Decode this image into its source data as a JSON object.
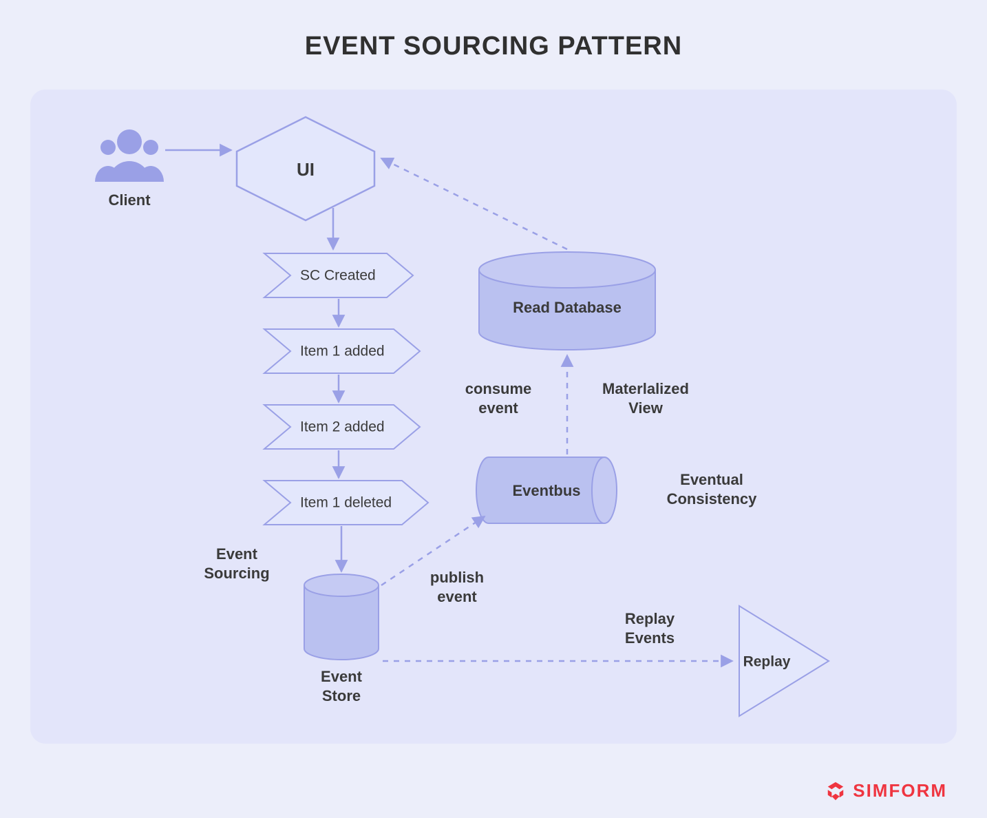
{
  "title": "EVENT SOURCING PATTERN",
  "brand": "SIMFORM",
  "nodes": {
    "client": "Client",
    "ui": "UI",
    "readdb": "Read Database",
    "eventbus": "Eventbus",
    "eventstore_l1": "Event",
    "eventstore_l2": "Store",
    "replay": "Replay"
  },
  "events": {
    "e1": "SC Created",
    "e2": "Item 1 added",
    "e3": "Item 2 added",
    "e4": "Item 1 deleted"
  },
  "labels": {
    "consume_l1": "consume",
    "consume_l2": "event",
    "matview_l1": "Materlalized",
    "matview_l2": "View",
    "eventual_l1": "Eventual",
    "eventual_l2": "Consistency",
    "evtsrc_l1": "Event",
    "evtsrc_l2": "Sourcing",
    "publish_l1": "publish",
    "publish_l2": "event",
    "replayevt_l1": "Replay",
    "replayevt_l2": "Events"
  },
  "colors": {
    "stroke": "#9aa0e6",
    "fillLight": "#e3e7fc",
    "fillMed": "#c5caf3",
    "fillMed2": "#bac1f0",
    "text": "#3a3a3a",
    "brand": "#ef3540"
  }
}
